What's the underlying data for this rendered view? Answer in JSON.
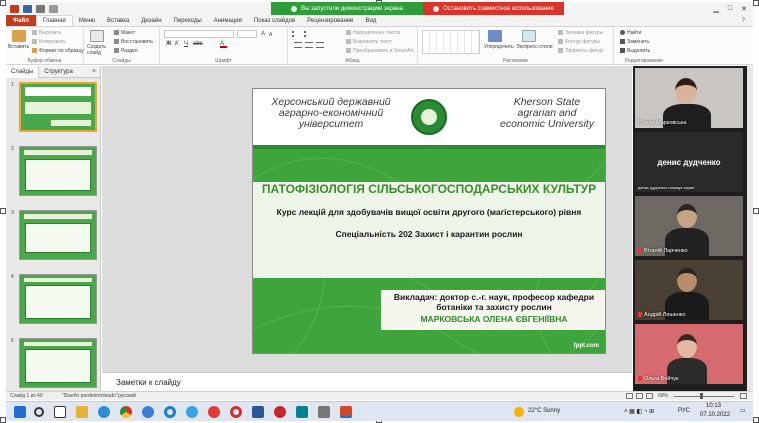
{
  "window": {
    "share_banner": "Вы запустили демонстрацию экрана",
    "stop_share": "Остановить совместное использование"
  },
  "ribbon": {
    "tabs": [
      "Файл",
      "Главная",
      "Меню",
      "Вставка",
      "Дизайн",
      "Переходы",
      "Анимация",
      "Показ слайдов",
      "Рецензирование",
      "Вид"
    ],
    "groups": {
      "clipboard": {
        "label": "Буфер обмена",
        "paste": "Вставить",
        "cut": "Вырезать",
        "copy": "Копировать",
        "format": "Формат по образцу"
      },
      "slides": {
        "label": "Слайды",
        "new_slide": "Создать слайд",
        "layout": "Макет",
        "reset": "Восстановить",
        "section": "Раздел"
      },
      "font": {
        "label": "Шрифт"
      },
      "paragraph": {
        "label": "Абзац",
        "text_direction": "Направление текста",
        "align_text": "Выровнять текст",
        "smartart": "Преобразовать в SmartArt"
      },
      "drawing": {
        "label": "Рисование",
        "arrange": "Упорядочить",
        "quick_styles": "Экспресс-стили",
        "shape_fill": "Заливка фигуры",
        "shape_outline": "Контур фигуры",
        "shape_effects": "Эффекты фигур"
      },
      "editing": {
        "label": "Редактирование",
        "find": "Найти",
        "replace": "Заменить",
        "select": "Выделить"
      }
    }
  },
  "left_panel": {
    "tabs": [
      "Слайды",
      "Структура"
    ],
    "close": "×",
    "thumb_numbers": [
      "1",
      "2",
      "3",
      "4",
      "5"
    ]
  },
  "slide": {
    "header_ua": "Херсонський державний аграрно-економічний університет",
    "header_en": "Kherson State agrarian and economic University",
    "title": "ПАТОФІЗІОЛОГІЯ СІЛЬСЬКОГОСПОДАРСЬКИХ КУЛЬТУР",
    "subtitle1": "Курс лекцій для здобувачів вищої освіти другого (магістерського) рівня",
    "subtitle2": "Спеціальність 202 Захист і карантин рослин",
    "lecturer": "Викладач: доктор с.-г. наук, професор кафедри ботаніки та захисту рослин",
    "lecturer_name": "МАРКОВСЬКА ОЛЕНА ЄВГЕНІЇВНА",
    "watermark": "fppt.com"
  },
  "notes": {
    "placeholder": "Заметки к слайду"
  },
  "gallery": {
    "participants": [
      {
        "name": "Олена Марковська"
      },
      {
        "name": "денис дудченко",
        "caption": "денис дудченко показує екран"
      },
      {
        "name": "Віталій Ларченко"
      },
      {
        "name": "Андрій Ляшенко"
      },
      {
        "name": "Ольга Бойчук"
      }
    ]
  },
  "status_bar": {
    "slide_info": "Слайд 1 из 40",
    "theme": "\"Diseño predeterminado\"",
    "language": "русский",
    "zoom": "69%"
  },
  "taskbar": {
    "weather": "22°C  Sunny",
    "lang": "РУС",
    "time": "10:13",
    "date": "07.10.2022"
  },
  "colors": {
    "slide_green": "#3ea53c",
    "title_green": "#3a8d2e",
    "file_tab": "#c43b1d",
    "share_green": "#2f9e3a",
    "share_red": "#d8342a"
  }
}
